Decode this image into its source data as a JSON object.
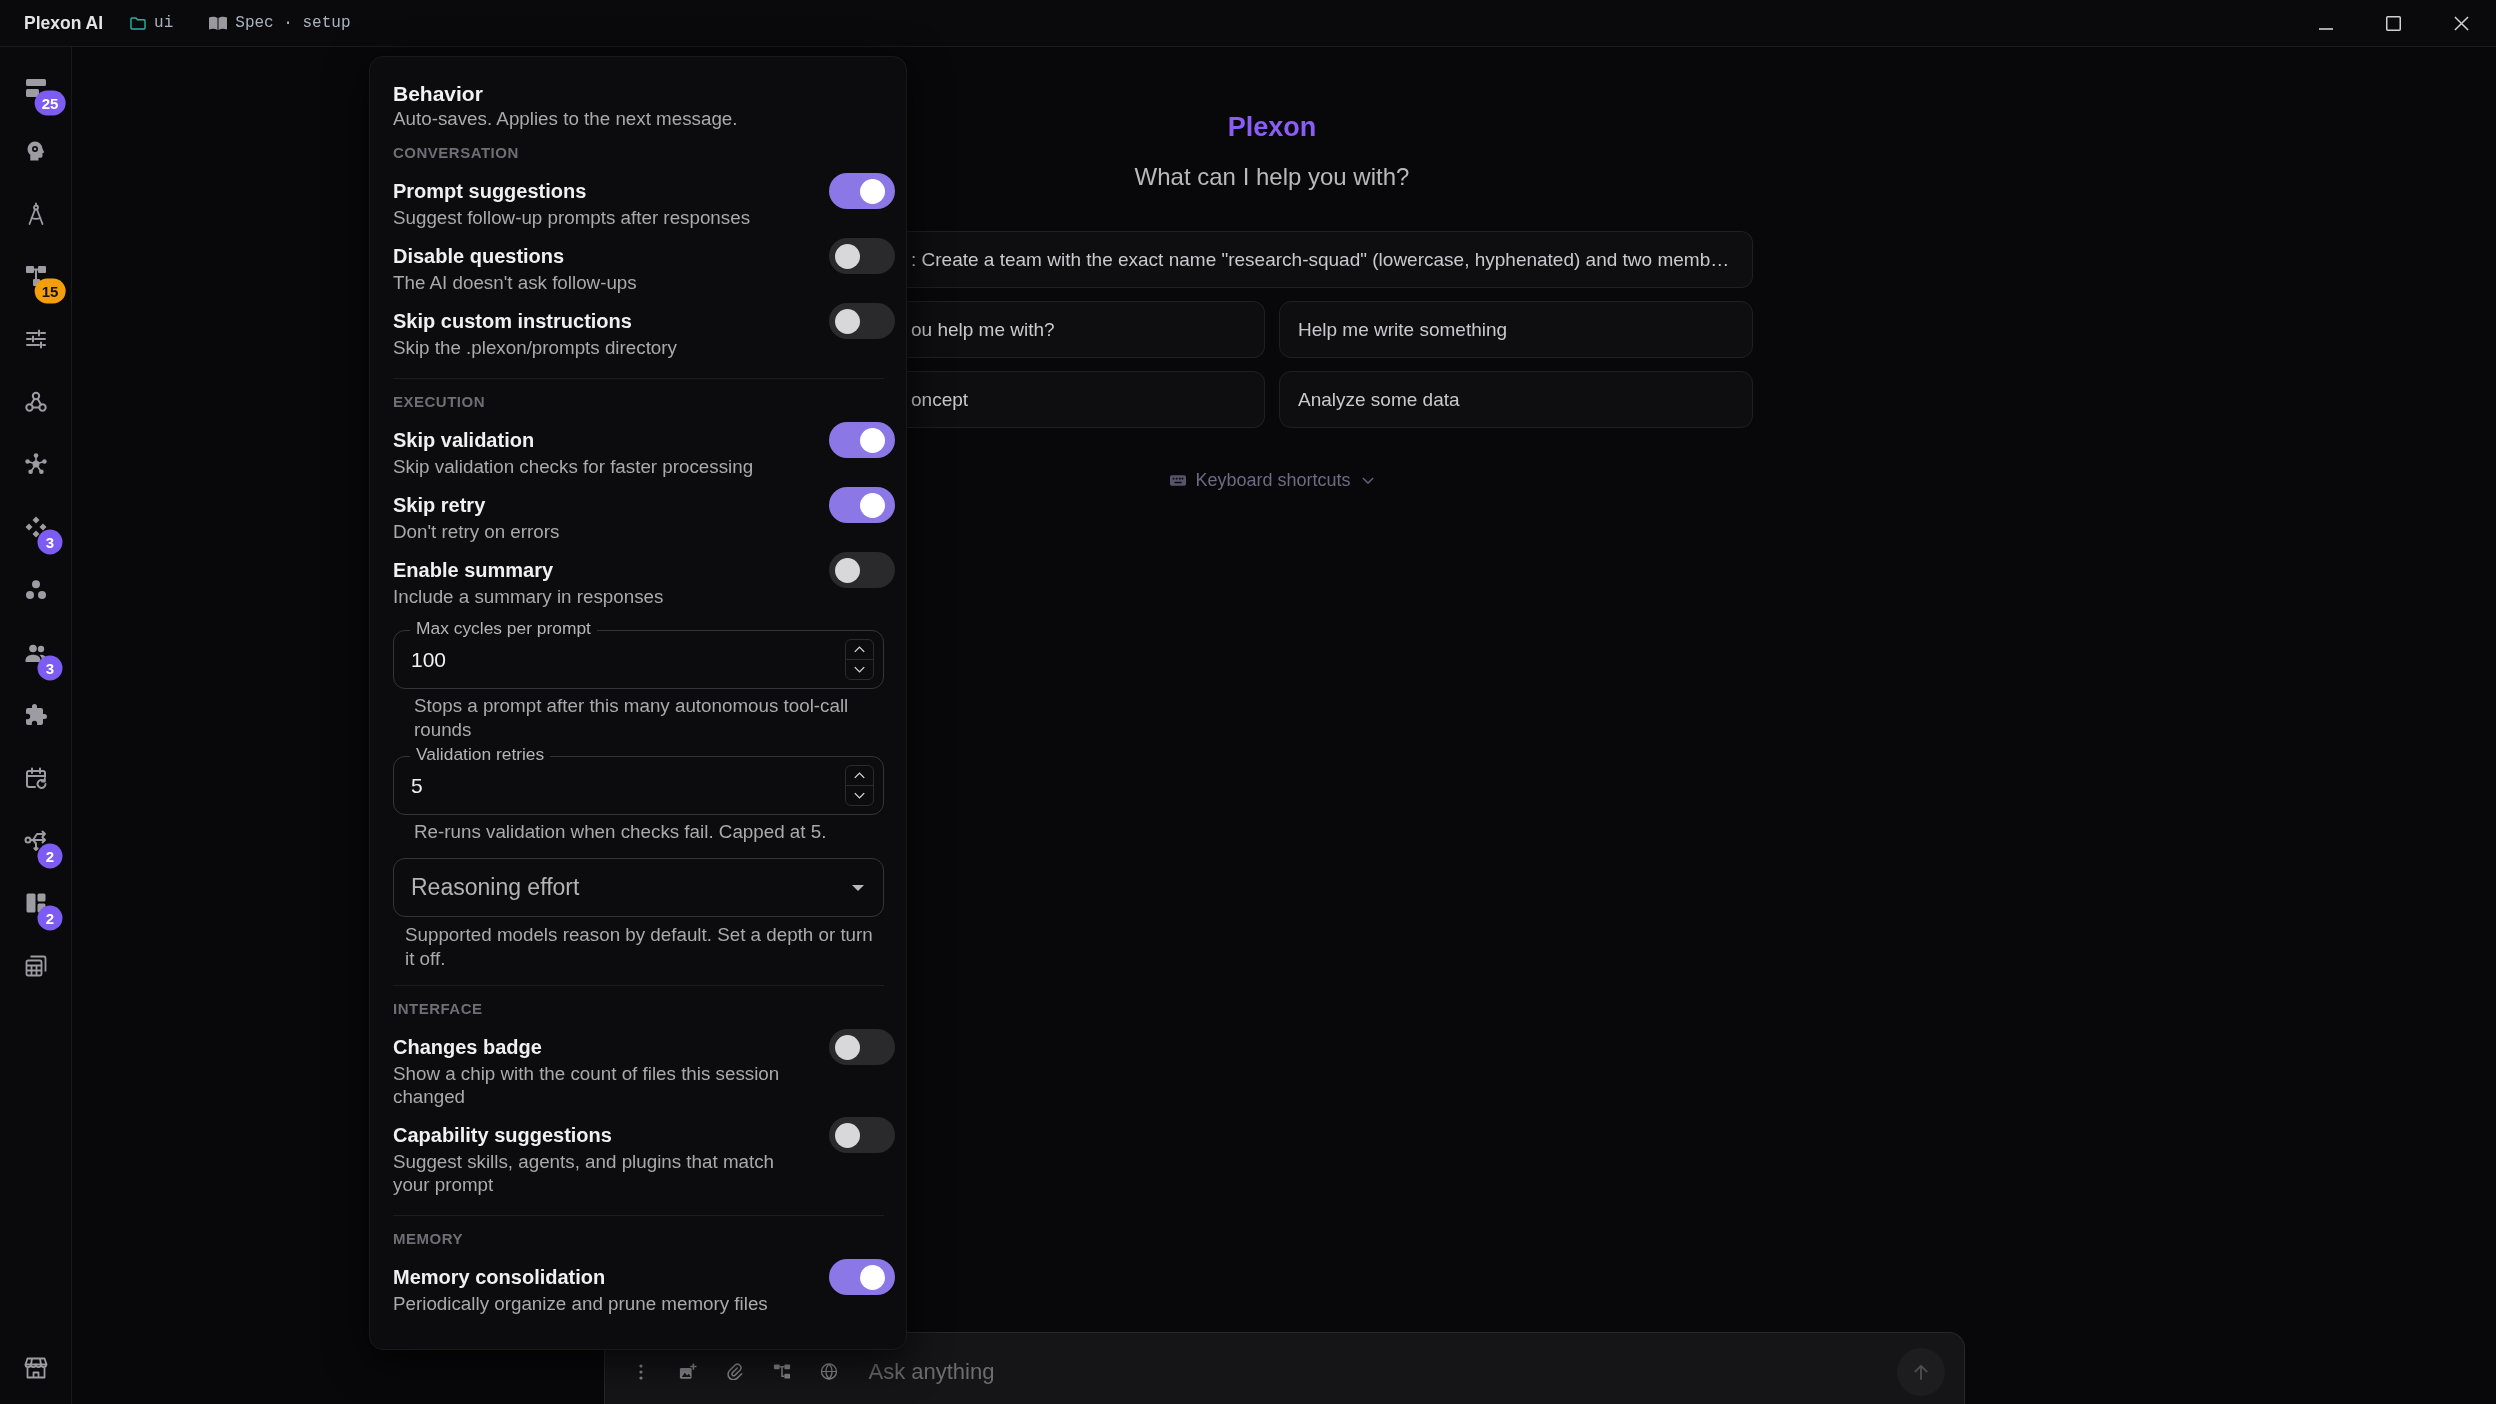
{
  "title_bar": {
    "app_name": "Plexon AI",
    "folder": "ui",
    "spec": "Spec · setup"
  },
  "sidebar": {
    "items": [
      {
        "kind": "stack",
        "badge": {
          "text": "25",
          "color": "#7c5cf2"
        }
      },
      {
        "kind": "head"
      },
      {
        "kind": "compass"
      },
      {
        "kind": "hierarchy",
        "badge": {
          "text": "15",
          "color": "#f59e0b"
        }
      },
      {
        "kind": "sliders"
      },
      {
        "kind": "rings"
      },
      {
        "kind": "network"
      },
      {
        "kind": "diamonds",
        "badge": {
          "text": "3",
          "color": "#7c5cf2"
        }
      },
      {
        "kind": "circles"
      },
      {
        "kind": "people",
        "badge": {
          "text": "3",
          "color": "#7c5cf2"
        }
      },
      {
        "kind": "puzzle"
      },
      {
        "kind": "calendar"
      },
      {
        "kind": "fork",
        "badge": {
          "text": "2",
          "color": "#7c5cf2"
        }
      },
      {
        "kind": "layout",
        "badge": {
          "text": "2",
          "color": "#7c5cf2"
        }
      },
      {
        "kind": "tables"
      }
    ],
    "footer_items": [
      {
        "kind": "store"
      }
    ]
  },
  "settings_panel": {
    "title": "Behavior",
    "subtitle": "Auto-saves. Applies to the next message.",
    "sections": [
      {
        "heading": "CONVERSATION",
        "items": [
          {
            "kind": "toggle",
            "label": "Prompt suggestions",
            "description": "Suggest follow-up prompts after responses",
            "on": true
          },
          {
            "kind": "toggle",
            "label": "Disable questions",
            "description": "The AI doesn't ask follow-ups",
            "on": false
          },
          {
            "kind": "toggle",
            "label": "Skip custom instructions",
            "description": "Skip the .plexon/prompts directory",
            "on": false
          }
        ]
      },
      {
        "heading": "EXECUTION",
        "items": [
          {
            "kind": "toggle",
            "label": "Skip validation",
            "description": "Skip validation checks for faster processing",
            "on": true
          },
          {
            "kind": "toggle",
            "label": "Skip retry",
            "description": "Don't retry on errors",
            "on": true
          },
          {
            "kind": "toggle",
            "label": "Enable summary",
            "description": "Include a summary in responses",
            "on": false
          },
          {
            "kind": "number",
            "label": "Max cycles per prompt",
            "value": "100",
            "helper": "Stops a prompt after this many autonomous tool-call rounds"
          },
          {
            "kind": "number",
            "label": "Validation retries",
            "value": "5",
            "helper": "Re-runs validation when checks fail. Capped at 5."
          },
          {
            "kind": "select",
            "label": "Reasoning effort",
            "helper": "Supported models reason by default. Set a depth or turn it off."
          }
        ]
      },
      {
        "heading": "INTERFACE",
        "items": [
          {
            "kind": "toggle",
            "label": "Changes badge",
            "description": "Show a chip with the count of files this session changed",
            "on": false
          },
          {
            "kind": "toggle",
            "label": "Capability suggestions",
            "description": "Suggest skills, agents, and plugins that match your prompt",
            "on": false
          }
        ]
      },
      {
        "heading": "MEMORY",
        "items": [
          {
            "kind": "toggle",
            "label": "Memory consolidation",
            "description": "Periodically organize and prune memory files",
            "on": true
          }
        ]
      }
    ]
  },
  "main": {
    "brand": "Plexon",
    "greeting": "What can I help you with?",
    "suggestions": [
      ": Create a team with the exact name \"research-squad\" (lowercase, hyphenated) and two memb…",
      "ou help me with?",
      "Help me write something",
      "oncept",
      "Analyze some data"
    ],
    "shortcuts": {
      "label": "Keyboard shortcuts",
      "expanded": false
    }
  },
  "composer": {
    "placeholder": "Ask anything"
  }
}
